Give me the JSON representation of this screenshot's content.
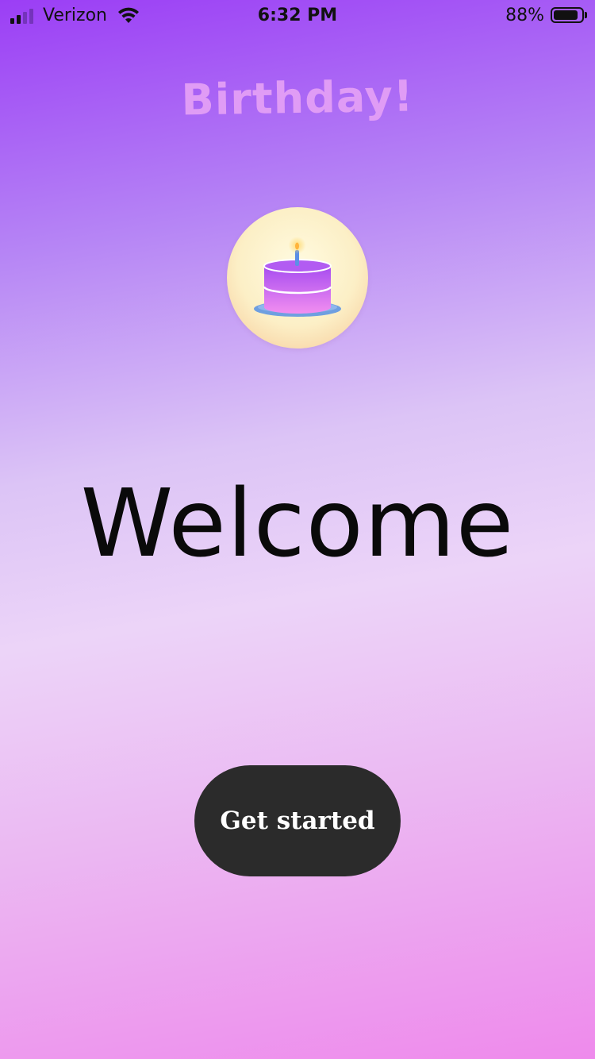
{
  "status_bar": {
    "carrier": "Verizon",
    "time": "6:32 PM",
    "battery_percent": "88%",
    "battery_level": 0.88,
    "signal_bars_active": 2,
    "signal_bars_total": 4
  },
  "app": {
    "title": "Birthday!",
    "logo_icon": "birthday-cake-icon"
  },
  "main": {
    "heading": "Welcome",
    "cta_label": "Get started"
  },
  "colors": {
    "title": "#e09cf5",
    "button_bg": "#2b2b2b",
    "button_text": "#ffffff",
    "gradient_top": "#9b3ef5",
    "gradient_bottom": "#ee8aec"
  }
}
